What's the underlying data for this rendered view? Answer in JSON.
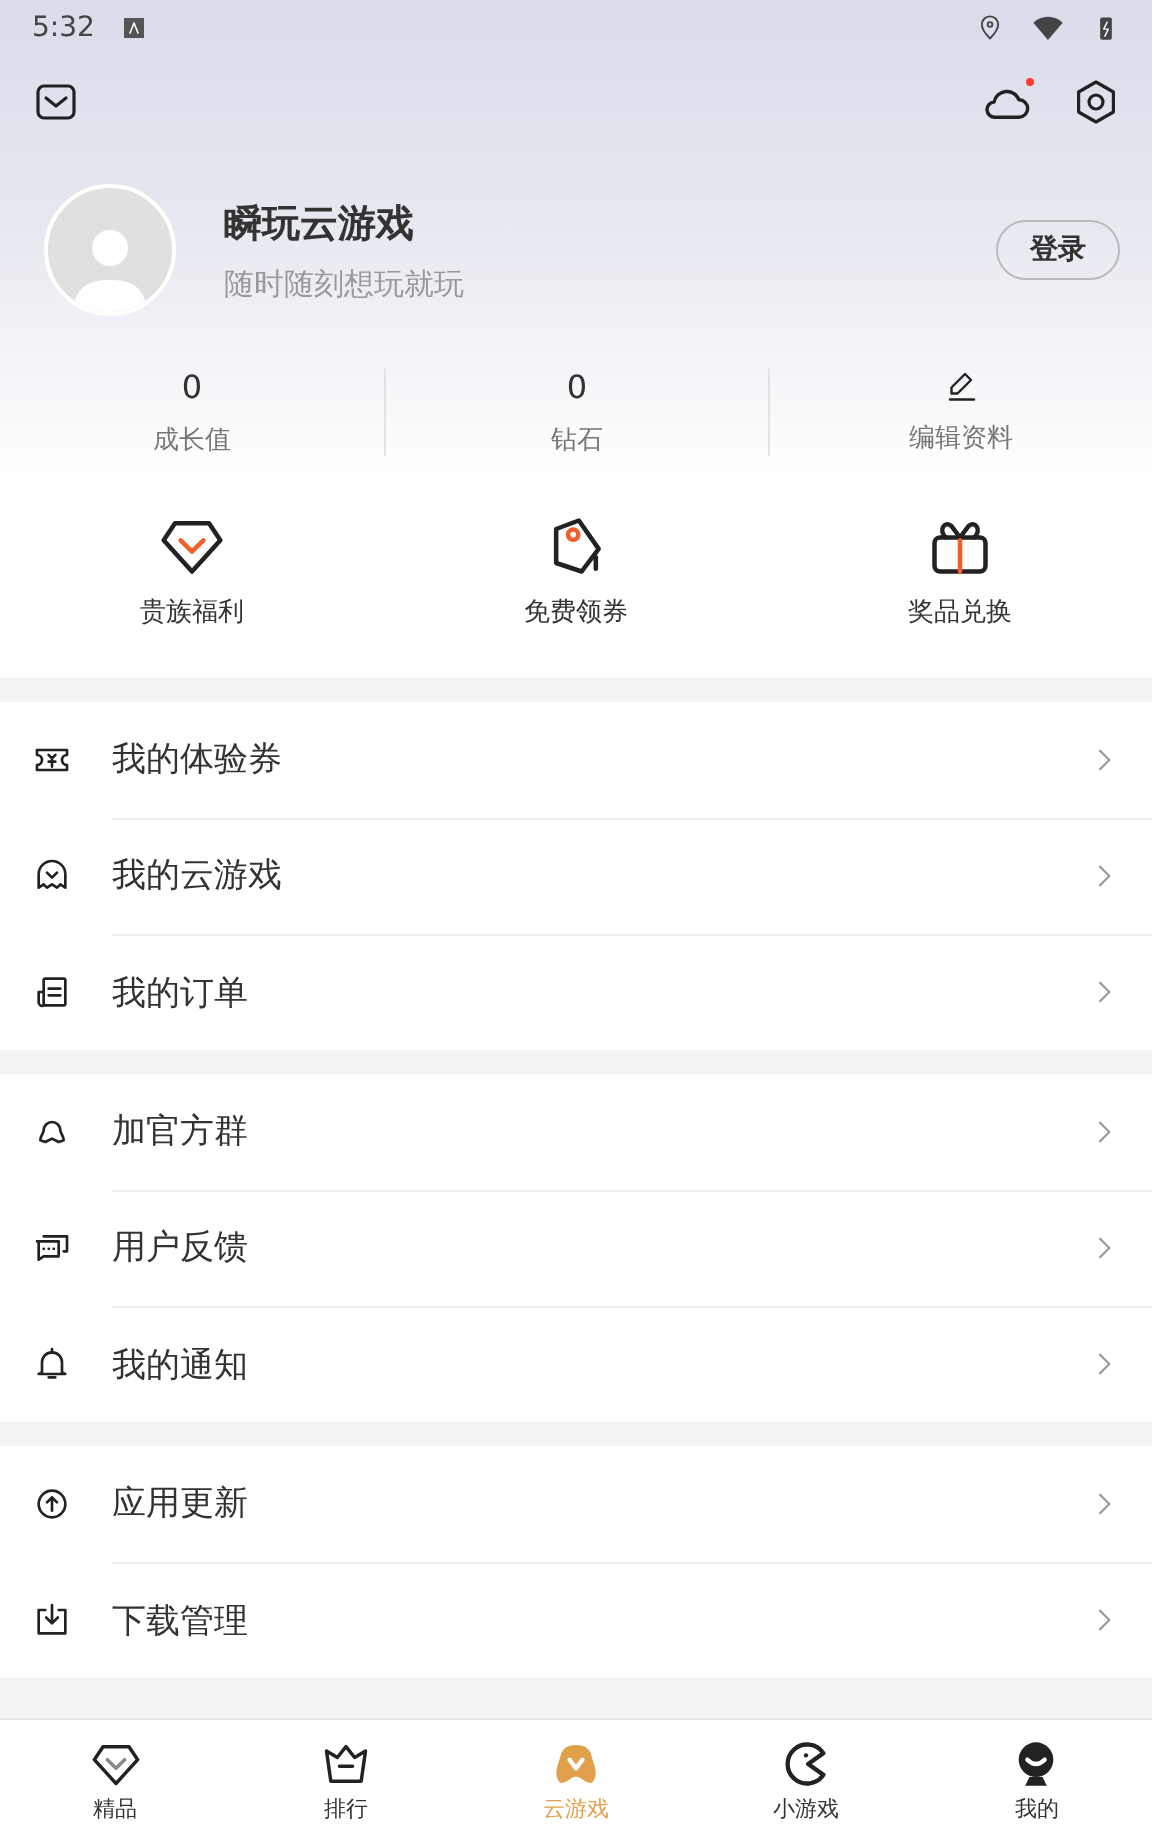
{
  "status_bar": {
    "time": "5:32"
  },
  "toolbar": {
    "cloud_notification": true
  },
  "profile": {
    "name": "瞬玩云游戏",
    "subtitle": "随时随刻想玩就玩",
    "login_button": "登录"
  },
  "stats": [
    {
      "kind": "value",
      "value": "0",
      "label": "成长值"
    },
    {
      "kind": "value",
      "value": "0",
      "label": "钻石"
    },
    {
      "kind": "edit",
      "label": "编辑资料"
    }
  ],
  "shortcuts": [
    {
      "label": "贵族福利"
    },
    {
      "label": "免费领券"
    },
    {
      "label": "奖品兑换"
    }
  ],
  "menu_groups": [
    [
      {
        "label": "我的体验券"
      },
      {
        "label": "我的云游戏"
      },
      {
        "label": "我的订单"
      }
    ],
    [
      {
        "label": "加官方群"
      },
      {
        "label": "用户反馈"
      },
      {
        "label": "我的通知"
      }
    ],
    [
      {
        "label": "应用更新"
      },
      {
        "label": "下载管理"
      }
    ]
  ],
  "tab_bar": [
    {
      "label": "精品",
      "selected": false
    },
    {
      "label": "排行",
      "selected": false
    },
    {
      "label": "云游戏",
      "selected": true
    },
    {
      "label": "小游戏",
      "selected": false
    },
    {
      "label": "我的",
      "selected": false
    }
  ]
}
